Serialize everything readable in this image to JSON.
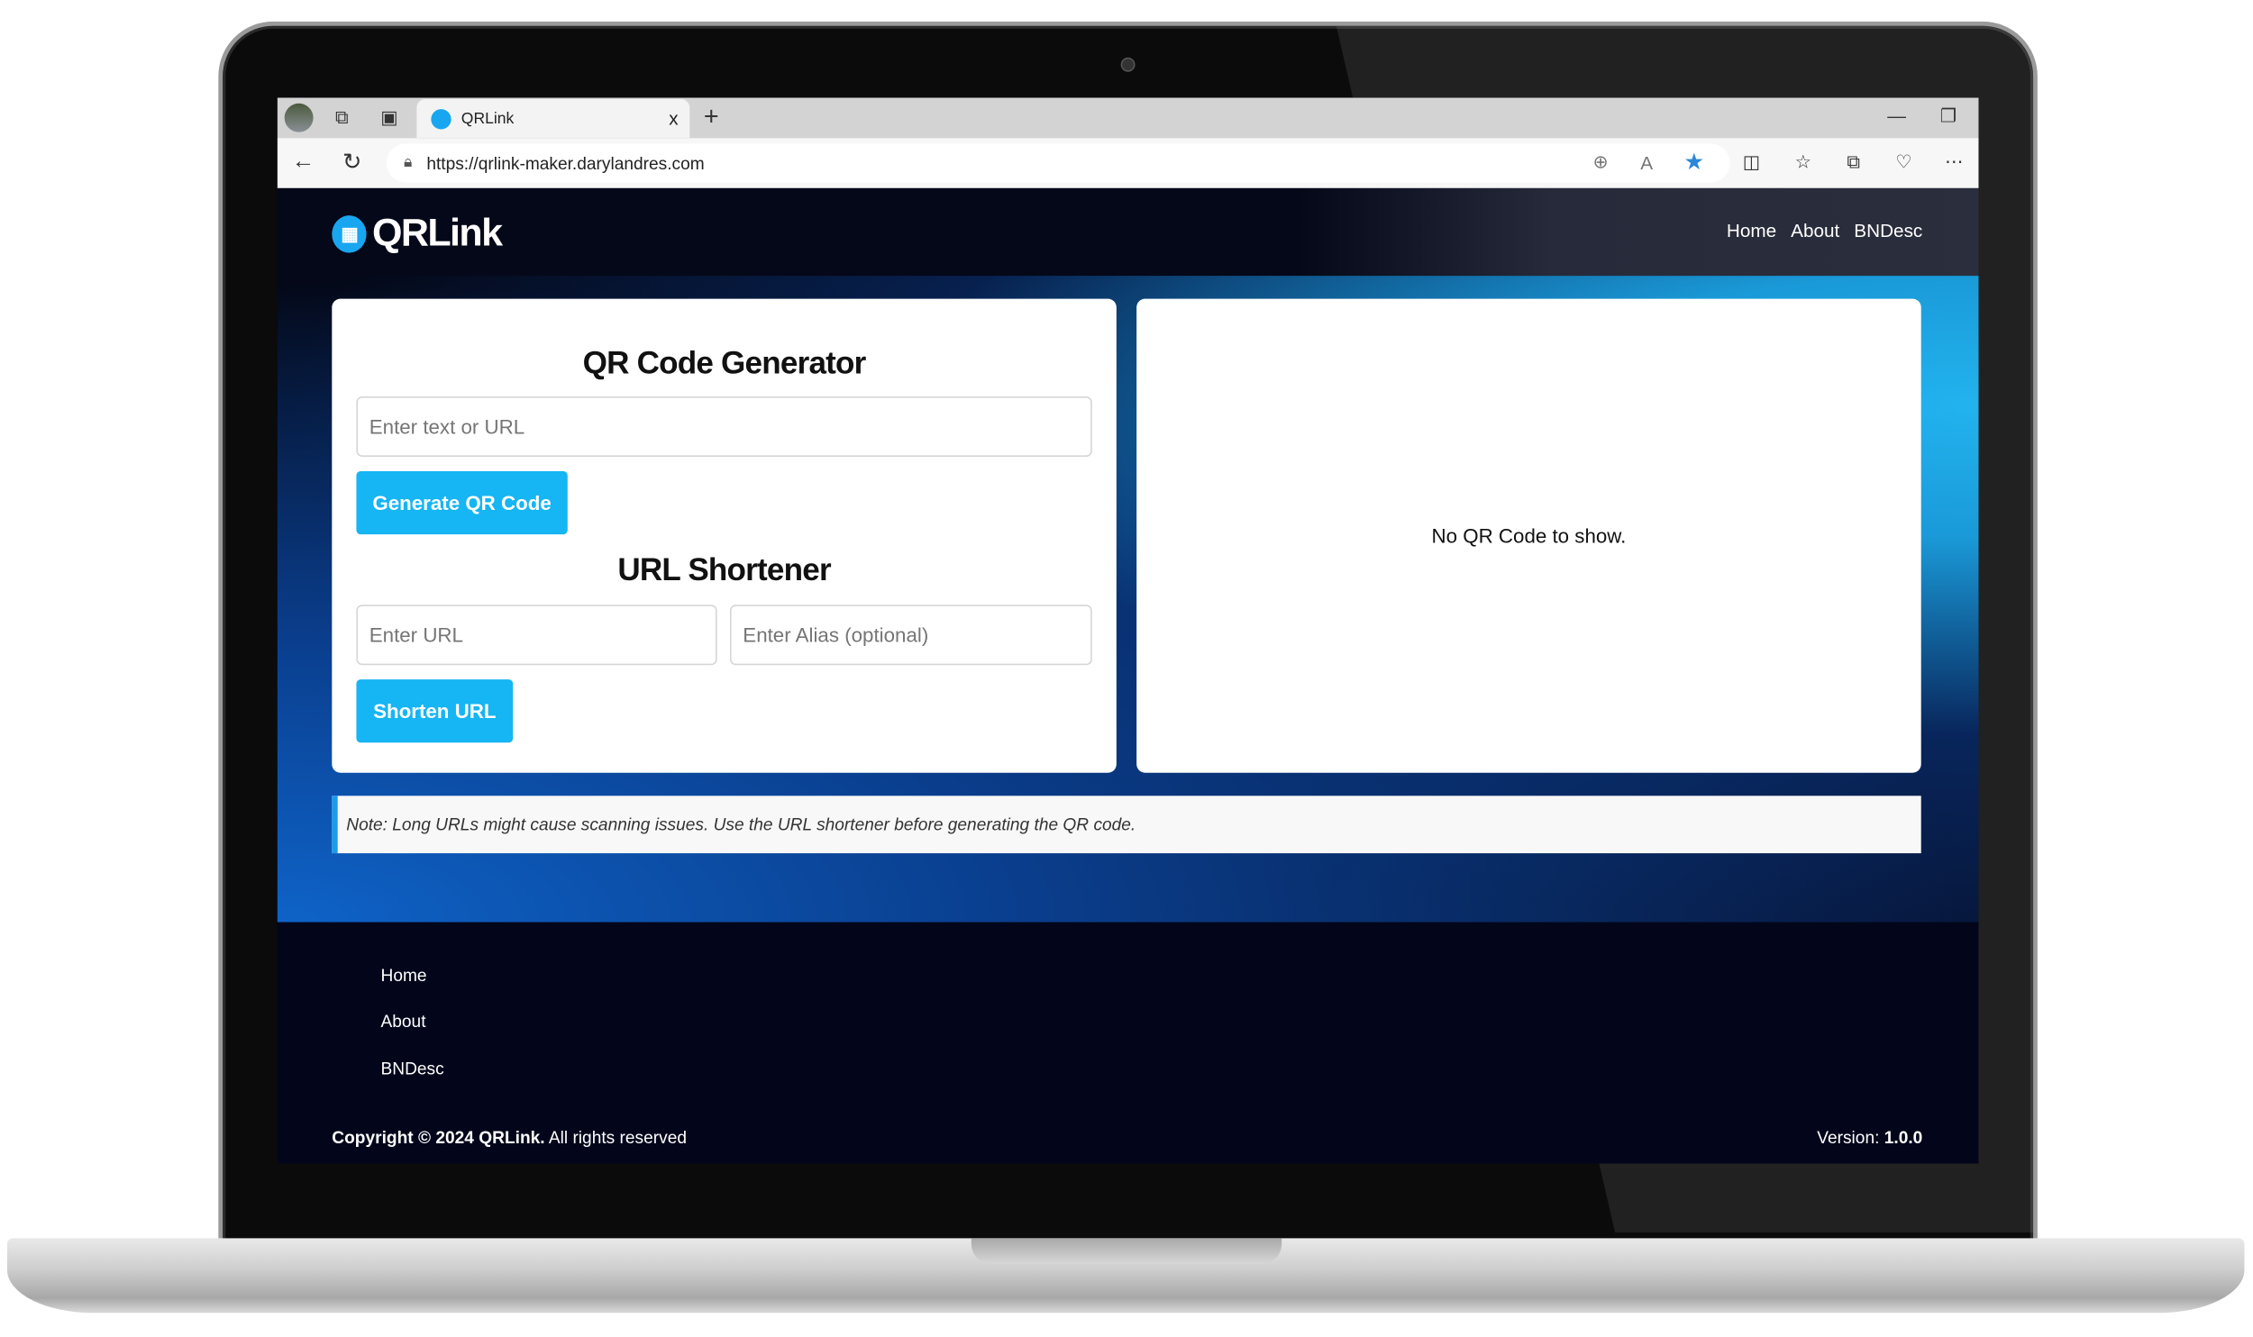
{
  "browser": {
    "tab_title": "QRLink",
    "tab_close": "x",
    "new_tab": "+",
    "url": "https://qrlink-maker.darylandres.com",
    "icons": [
      "profile-avatar",
      "workspaces-icon",
      "tab-actions-icon",
      "back-icon",
      "refresh-icon",
      "lock-icon",
      "zoom-icon",
      "read-aloud-icon",
      "favorite-star-icon",
      "split-screen-icon",
      "favorites-icon",
      "collections-icon",
      "browser-essentials-icon",
      "more-icon"
    ],
    "accent": "#2b88d8"
  },
  "header": {
    "logo": "QRLink",
    "nav": [
      "Home",
      "About",
      "BNDesc"
    ]
  },
  "qr": {
    "title": "QR Code Generator",
    "placeholder": "Enter text or URL",
    "button": "Generate QR Code"
  },
  "shortener": {
    "title": "URL Shortener",
    "url_placeholder": "Enter URL",
    "alias_placeholder": "Enter Alias (optional)",
    "button": "Shorten URL"
  },
  "preview": {
    "empty": "No QR Code to show."
  },
  "note": "Note: Long URLs might cause scanning issues. Use the URL shortener before generating the QR code.",
  "footer": {
    "links": [
      "Home",
      "About",
      "BNDesc"
    ],
    "copyright_bold": "Copyright © 2024 QRLink.",
    "copyright_rest": " All rights reserved",
    "version_label": "Version: ",
    "version": "1.0.0"
  },
  "colors": {
    "button": "#16b5f3",
    "note_border": "#1c9be8",
    "header_bg": "#050818"
  }
}
